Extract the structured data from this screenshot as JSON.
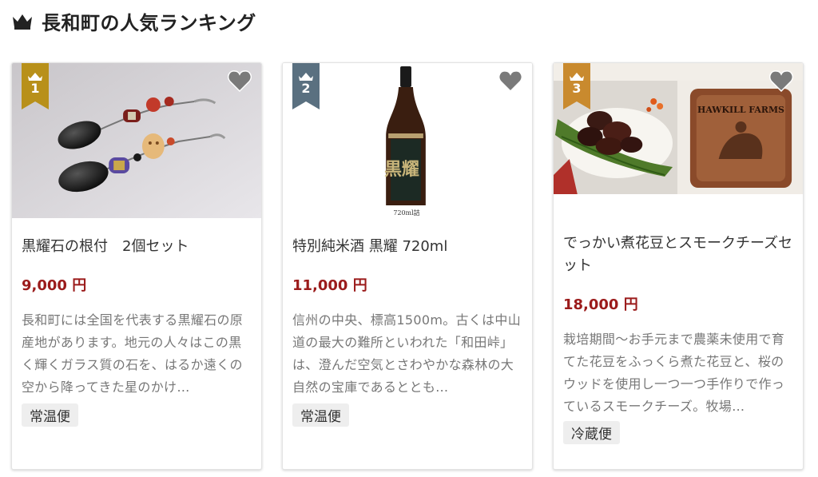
{
  "header": {
    "title": "長和町の人気ランキング",
    "icon": "crown-icon"
  },
  "colors": {
    "rank1": "#b8901a",
    "rank2": "#5a7080",
    "rank3": "#c98a2e",
    "price": "#9b1b1b",
    "heart": "#7a7a7a"
  },
  "cards": [
    {
      "rank": "1",
      "title": "黒耀石の根付　2個セット",
      "price": "9,000 円",
      "desc": "長和町には全国を代表する黒耀石の原産地があります。地元の人々はこの黒く輝くガラス質の石を、はるか遠くの空から降ってきた星のかけ…",
      "tag": "常温便"
    },
    {
      "rank": "2",
      "title": "特別純米酒 黒耀 720ml",
      "price": "11,000 円",
      "desc": "信州の中央、標高1500m。古くは中山道の最大の難所といわれた「和田峠」は、澄んだ空気とさわやかな森林の大自然の宝庫であるととも…",
      "tag": "常温便",
      "bottle_label": "720ml詰",
      "bottle_text": "黒耀"
    },
    {
      "rank": "3",
      "title": "でっかい煮花豆とスモークチーズセット",
      "price": "18,000 円",
      "desc": "栽培期間〜お手元まで農薬未使用で育てた花豆をふっくら煮た花豆と、桜のウッドを使用し一つ一つ手作りで作っているスモークチーズ。牧場…",
      "tag": "冷蔵便",
      "cheese_text": "HAWKILL FARMS"
    }
  ]
}
